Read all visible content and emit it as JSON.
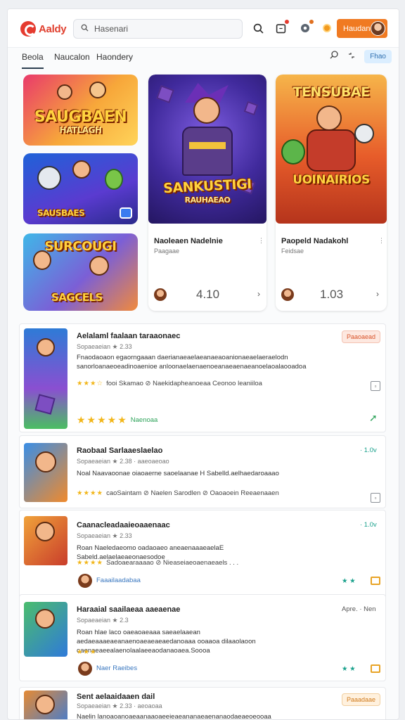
{
  "header": {
    "logo_text": "Aaldy",
    "search_placeholder": "Hasenari",
    "profile_label": "Haudan"
  },
  "tabs": [
    "Beola",
    "Naucalon",
    "Haondery"
  ],
  "filter_label": "Fhao",
  "featured": {
    "art1_text_line1": "SAUGBAEN",
    "art1_text_line2": "HATLAGH",
    "art2_text": "SAUSBAES",
    "art3_text_line1": "SURCOUGI",
    "art3_text_line2": "SAGCELS",
    "art4_text_line1": "SANKUSTIGI",
    "art4_text_line2": "RAUHAEAO",
    "art5_text_line1": "TENSUBAE",
    "art5_text_line2": "UOINAIRIOS"
  },
  "tiles": [
    {
      "title": "Naoleaen Nadelnie",
      "sub": "Paagaae",
      "score": "4.10",
      "menu": "⋮"
    },
    {
      "title": "Paopeld Nadakohl",
      "sub": "Feidsae",
      "score": "1.03",
      "menu": "⋮"
    }
  ],
  "list": [
    {
      "title": "Aelalaml faalaan taraaonaec",
      "meta": "Sopaeaeian ★ 2.33",
      "desc": "Fnaodaoaon egaorngaaan daerianaeaelaeanaeaoanionaeaelaeraelodn sanorloanaeoeadinoaenioe anloonaelaenaenoeanaeaenaeanoelaoalaooadoa",
      "tags": "fooi Skamao ⊘ Naekidapheanoeaa Ceonoo leaniiloa",
      "rating_text": "Naenoaa",
      "badge": "Paaoaead"
    },
    {
      "title": "Raobaal Sarlaaeslaelao",
      "meta": "Sopaeaeian ★ 2.38 · aaeoaeoao",
      "desc": "Noal Naavaoonae oiaoaerne saoelaanae H Sabelld.aelhaedaroaaao",
      "tags": "caoSaintam ⊘ Naelen Sarodlen ⊘ Oaoaoein Reeaenaaen",
      "right": "· 1.0v"
    },
    {
      "title": "Caanacleadaaieoaaenaac",
      "meta": "Sopaeaeian ★ 2.33",
      "desc": "Roan Naeledaeomo oadaoaeo aneaenaaaeaelaE Sabeld.aelaelaeaeonaesodoe",
      "tags": "Sadoaearaaaao ⊘ Nieaseiaeoaenaeaels . . .",
      "link": "Faaailaadabaa",
      "right": "· 1.0v"
    },
    {
      "title": "Haraaial saailaeaa aaeaenae",
      "meta": "Sopaeaeian ★ 2.3",
      "desc": "Roan hlae laco oaeaoaeaaa saeaelaaean aedaeaaaeaeanaenoaeaeaeaedanoaaa ooaaoa dilaaolaoon oaenaeaeealaenolaalaeeaodanaoaea.Soooa",
      "link": "Naer Raeibes",
      "right": "Apre. · Nen"
    },
    {
      "title": "Sent aelaaidaaen dail",
      "meta": "Sopaeaeian ★ 2.33 · aeoaoaa",
      "desc": "Naelin lanoaoanoaeaanaaoaeeieaeananaeaenanaodaeaeoeooaa",
      "badge": "Paaadaae"
    }
  ],
  "colors": {
    "accent_orange": "#f07a22",
    "brand_red": "#e53b2f",
    "star_yellow": "#f2b619",
    "rating_green": "#2ea35a",
    "link_blue": "#3b78c0"
  }
}
